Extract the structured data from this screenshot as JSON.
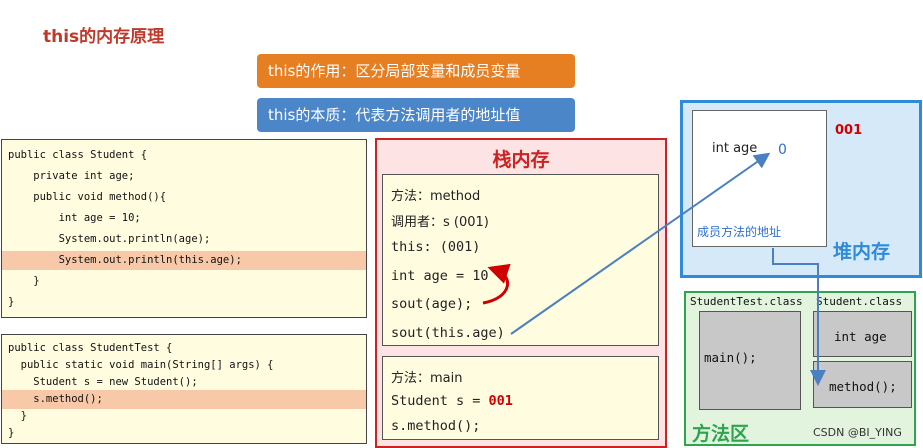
{
  "title": "this的内存原理",
  "callouts": {
    "role": "this的作用：区分局部变量和成员变量",
    "essence": "this的本质：代表方法调用者的地址值"
  },
  "student_code": [
    {
      "text": "public class Student {",
      "highlight": false
    },
    {
      "text": "    private int age;",
      "highlight": false
    },
    {
      "text": "    public void method(){",
      "highlight": false
    },
    {
      "text": "        int age = 10;",
      "highlight": false
    },
    {
      "text": "        System.out.println(age);",
      "highlight": false
    },
    {
      "text": "        System.out.println(this.age);",
      "highlight": true
    },
    {
      "text": "    }",
      "highlight": false
    },
    {
      "text": "}",
      "highlight": false
    }
  ],
  "studenttest_code": [
    {
      "text": "public class StudentTest {",
      "highlight": false
    },
    {
      "text": "  public static void main(String[] args) {",
      "highlight": false
    },
    {
      "text": "    Student s = new Student();",
      "highlight": false
    },
    {
      "text": "    s.method();",
      "highlight": true
    },
    {
      "text": "  }",
      "highlight": false
    },
    {
      "text": "}",
      "highlight": false
    }
  ],
  "stack": {
    "title": "栈内存",
    "method_frame": {
      "method_label": "方法：method",
      "caller_label": "调用者：s (001)",
      "this_label": "this:  (001)",
      "local_var": "int age = 10",
      "sout_age": "sout(age);",
      "sout_this_age": "sout(this.age)"
    },
    "main_frame": {
      "method_label": "方法：main",
      "student_decl": "Student s = ",
      "student_addr": "001",
      "call": "s.method();"
    }
  },
  "heap": {
    "title": "堆内存",
    "address": "001",
    "field_label": "int age",
    "field_value": "0",
    "method_addr_label": "成员方法的地址"
  },
  "method_area": {
    "title": "方法区",
    "classes": [
      {
        "name": "StudentTest.class",
        "members": [
          "main();"
        ]
      },
      {
        "name": "Student.class",
        "members": [
          "int age",
          "method();"
        ]
      }
    ]
  },
  "watermark": "CSDN @BI_YING",
  "colors": {
    "title_red": "#c0392b",
    "orange": "#e67e22",
    "blue": "#4a86c8",
    "stack_red": "#cc2222",
    "heap_blue": "#2f8bd8",
    "method_green": "#2ea44f",
    "code_bg": "#fffce0",
    "highlight": "#f8c9a9"
  }
}
